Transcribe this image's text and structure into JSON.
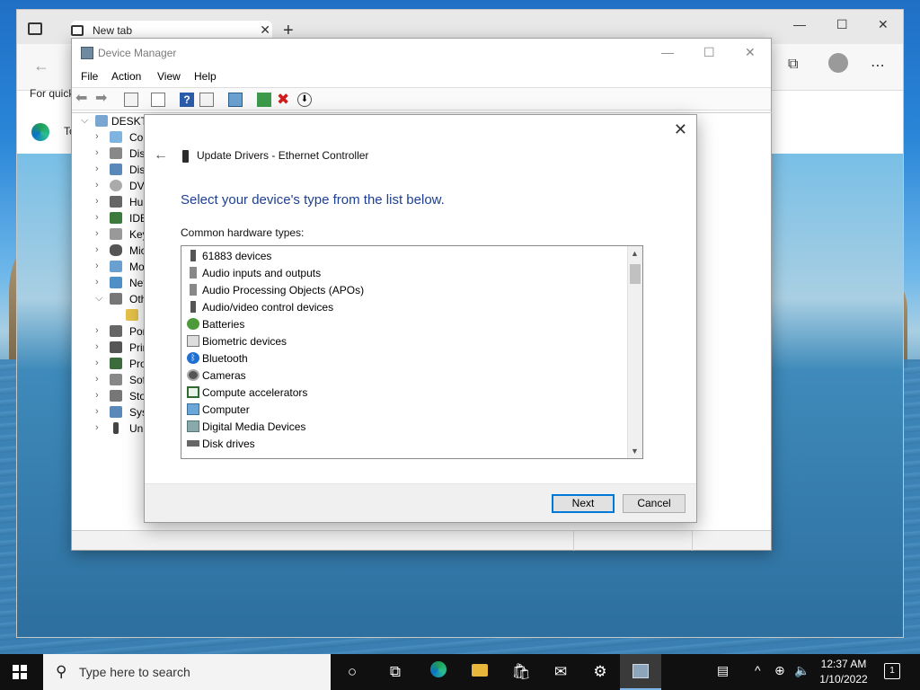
{
  "browser": {
    "tab_title": "New tab",
    "favorites_hint": "For quick",
    "edge_item": "To"
  },
  "device_manager": {
    "title": "Device Manager",
    "menu": [
      "File",
      "Action",
      "View",
      "Help"
    ],
    "tree_root": "DESKTO",
    "tree_items": [
      "Cor",
      "Disk",
      "Disp",
      "DVD",
      "Hum",
      "IDE",
      "Key",
      "Mic",
      "Mo",
      "Net",
      "Oth",
      "",
      "Por",
      "Prin",
      "Pro",
      "Soft",
      "Sto",
      "Syst",
      "Uni"
    ]
  },
  "dialog": {
    "title": "Update Drivers - Ethernet Controller",
    "heading": "Select your device's type from the list below.",
    "list_label": "Common hardware types:",
    "items": [
      "61883 devices",
      "Audio inputs and outputs",
      "Audio Processing Objects (APOs)",
      "Audio/video control devices",
      "Batteries",
      "Biometric devices",
      "Bluetooth",
      "Cameras",
      "Compute accelerators",
      "Computer",
      "Digital Media Devices",
      "Disk drives"
    ],
    "next_label": "Next",
    "cancel_label": "Cancel"
  },
  "taskbar": {
    "search_placeholder": "Type here to search",
    "time": "12:37 AM",
    "date": "1/10/2022",
    "notification_count": "1"
  },
  "colors": {
    "accent": "#0078d7",
    "heading": "#1d3f93",
    "taskbar": "#101010"
  }
}
